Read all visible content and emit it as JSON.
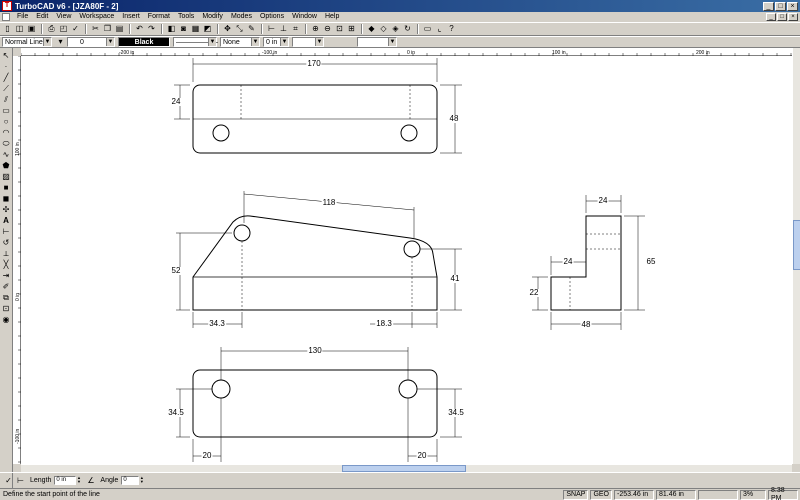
{
  "window": {
    "title": "TurboCAD v6 - [JZA80F - 2]",
    "app_icon": "turbocad-logo-icon",
    "controls": [
      "_",
      "□",
      "×"
    ]
  },
  "menu": {
    "items": [
      "File",
      "Edit",
      "View",
      "Workspace",
      "Insert",
      "Format",
      "Tools",
      "Modify",
      "Modes",
      "Options",
      "Window",
      "Help"
    ],
    "mdi_controls": [
      "_",
      "□",
      "×"
    ]
  },
  "toolbar2": {
    "line_style": "Normal Lines",
    "layer_value": "0",
    "pen_color": "Black",
    "pen_style": "——————",
    "fill": "None",
    "width": "0 in"
  },
  "rulers": {
    "horizontal_labels": [
      "-200 in",
      "-100 in",
      "0 in",
      "100 in",
      "200 in"
    ],
    "vertical_labels": [
      "100 in",
      "0 in",
      "-100 in"
    ]
  },
  "drawing": {
    "top_view": {
      "width_dim": "170",
      "left_dim": "24",
      "right_dim": "48"
    },
    "front_view": {
      "slant_dim": "118",
      "left_height": "52",
      "right_height": "41",
      "left_offset": "34.3",
      "right_offset": "18.3"
    },
    "bottom_view": {
      "width_dim": "130",
      "left_dim": "34.5",
      "right_dim": "34.5",
      "left_edge": "20",
      "right_edge": "20"
    },
    "side_view": {
      "top_dim": "24",
      "mid_dim": "24",
      "height_dim": "65",
      "low_dim": "22",
      "base_dim": "48"
    }
  },
  "inspector": {
    "length_label": "Length",
    "length_value": "0 in",
    "angle_label": "Angle",
    "angle_value": "0"
  },
  "status": {
    "message": "Define the start point of the line",
    "snap": "SNAP",
    "geo": "GEO",
    "x": "-253.46 in",
    "y": "81.46 in",
    "z": "",
    "zoom": "3%",
    "time": "8:38 PM"
  }
}
